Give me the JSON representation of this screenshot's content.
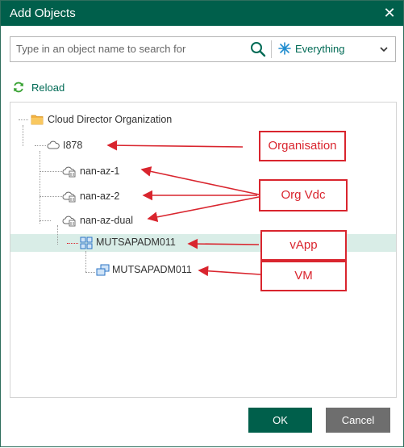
{
  "dialog": {
    "title": "Add Objects",
    "close_glyph": "✕"
  },
  "search": {
    "placeholder": "Type in an object name to search for",
    "value": "",
    "scope_label": "Everything",
    "icon": "search-icon"
  },
  "reload": {
    "label": "Reload",
    "icon": "refresh-icon"
  },
  "tree": {
    "nodes": [
      {
        "label": "Cloud Director Organization",
        "icon": "folder-icon"
      },
      {
        "label": "I878",
        "icon": "cloud-icon"
      },
      {
        "label": "nan-az-1",
        "icon": "org-vdc-icon"
      },
      {
        "label": "nan-az-2",
        "icon": "org-vdc-icon"
      },
      {
        "label": "nan-az-dual",
        "icon": "org-vdc-icon"
      },
      {
        "label": "MUTSAPADM011",
        "icon": "vapp-icon",
        "selected": true
      },
      {
        "label": "MUTSAPADM011",
        "icon": "vm-icon"
      }
    ]
  },
  "annotations": {
    "organisation": "Organisation",
    "org_vdc": "Org Vdc",
    "vapp": "vApp",
    "vm": "VM"
  },
  "buttons": {
    "ok": "OK",
    "cancel": "Cancel"
  },
  "colors": {
    "brand": "#005f4b",
    "accent": "#006a55",
    "annotation": "#d9252e",
    "selection": "#d9ede7"
  }
}
